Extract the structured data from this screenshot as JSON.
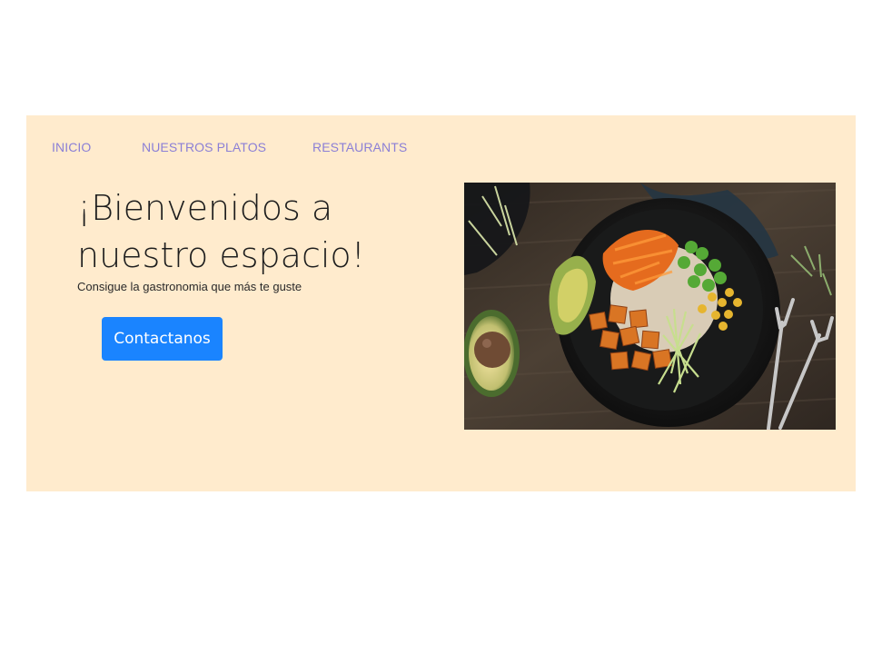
{
  "nav": {
    "items": [
      {
        "label": "INICIO"
      },
      {
        "label": "NUESTROS PLATOS"
      },
      {
        "label": "RESTAURANTS"
      }
    ]
  },
  "hero": {
    "title": "¡Bienvenidos a nuestro espacio!",
    "subtitle": "Consigue la gastronomia que más te guste",
    "cta_label": "Contactanos",
    "image_icon": "food-bowl-photo"
  },
  "colors": {
    "hero_background": "#ffebcd",
    "nav_link": "#8b7fd6",
    "button": "#1a84ff",
    "button_text": "#ffffff"
  }
}
